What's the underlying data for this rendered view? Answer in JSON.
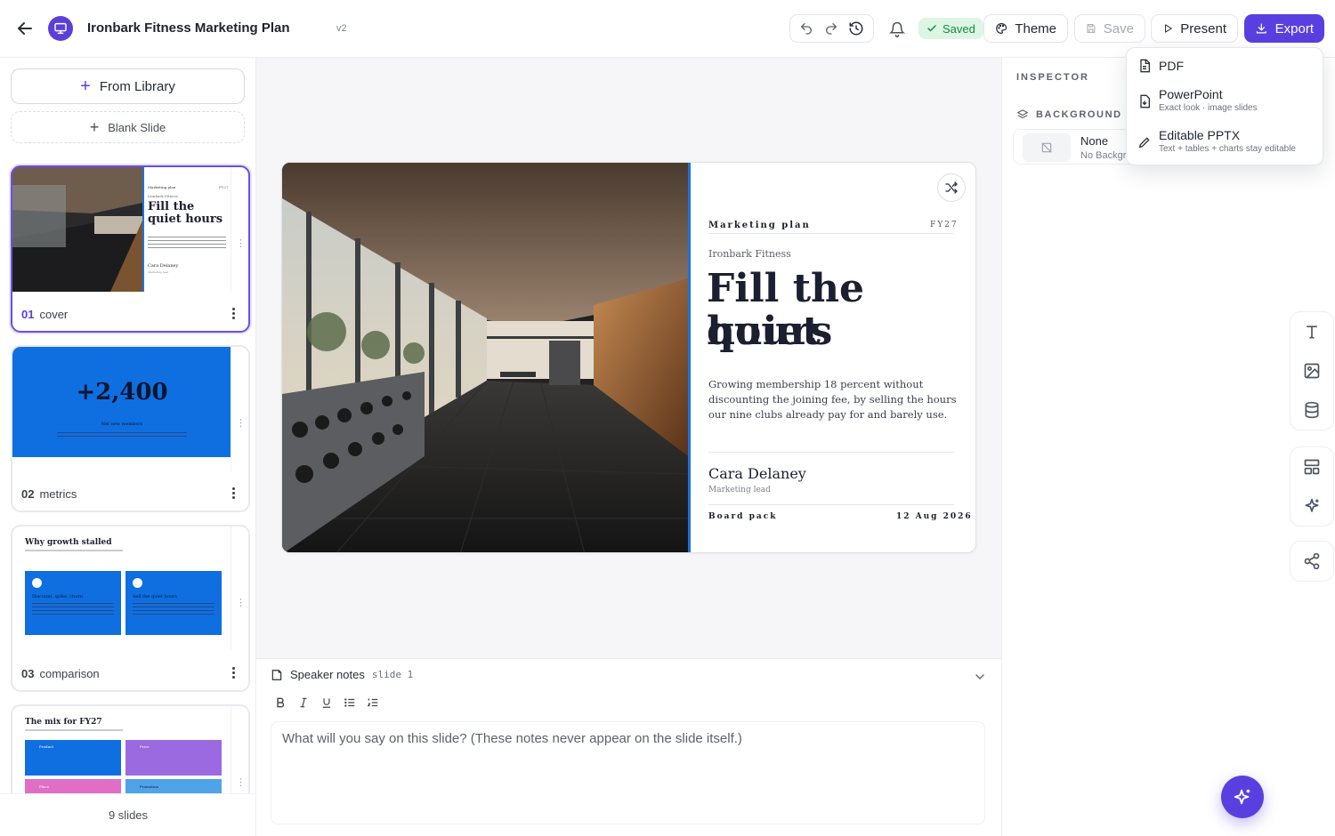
{
  "header": {
    "title": "Ironbark Fitness Marketing Plan",
    "version": "v2",
    "saved_label": "Saved",
    "theme_label": "Theme",
    "save_label": "Save",
    "present_label": "Present",
    "export_label": "Export"
  },
  "export_menu": {
    "items": [
      {
        "label": "PDF",
        "sub": ""
      },
      {
        "label": "PowerPoint",
        "sub": "Exact look · image slides"
      },
      {
        "label": "Editable PPTX",
        "sub": "Text + tables + charts stay editable"
      }
    ]
  },
  "sidebar": {
    "from_library": "From Library",
    "blank_slide": "Blank Slide",
    "slide_count": "9 slides",
    "slides": [
      {
        "num": "01",
        "name": "cover"
      },
      {
        "num": "02",
        "name": "metrics"
      },
      {
        "num": "03",
        "name": "comparison"
      },
      {
        "num": "04",
        "name": ""
      }
    ],
    "thumb1": {
      "kicker": "Marketing plan",
      "tag": "FY27",
      "org": "Ironbark Fitness",
      "title": "Fill the quiet hours",
      "person": "Cara Delaney",
      "role": "Marketing lead"
    },
    "thumb2": {
      "big": "+2,400",
      "label": "Net new members"
    },
    "thumb3": {
      "title": "Why growth stalled",
      "left_title": "Discount, spike, churn",
      "right_title": "Sell the quiet hours"
    },
    "thumb4": {
      "title": "The mix for FY27",
      "c1": "Product",
      "c2": "Price",
      "c3": "Place",
      "c4": "Promotion"
    }
  },
  "slide": {
    "kicker": "Marketing plan",
    "tag": "FY27",
    "org": "Ironbark Fitness",
    "title_line1": "Fill the quiet",
    "title_line2": "hours",
    "body": "Growing membership 18 percent without discounting the joining fee, by selling the hours our nine clubs already pay for and barely use.",
    "person": "Cara Delaney",
    "role": "Marketing lead",
    "footer_left": "Board pack",
    "footer_right": "12 Aug 2026"
  },
  "notes": {
    "heading": "Speaker notes",
    "slide_ref": "slide 1",
    "placeholder": "What will you say on this slide? (These notes never appear on the slide itself.)"
  },
  "inspector": {
    "heading": "INSPECTOR",
    "background_heading": "BACKGROUND",
    "bg_name": "None",
    "bg_sub": "No Background"
  },
  "colors": {
    "accent": "#5a3fe0",
    "slide_blue": "#1e72d8",
    "saved_bg": "#dcf6e3",
    "saved_text": "#198a45"
  }
}
